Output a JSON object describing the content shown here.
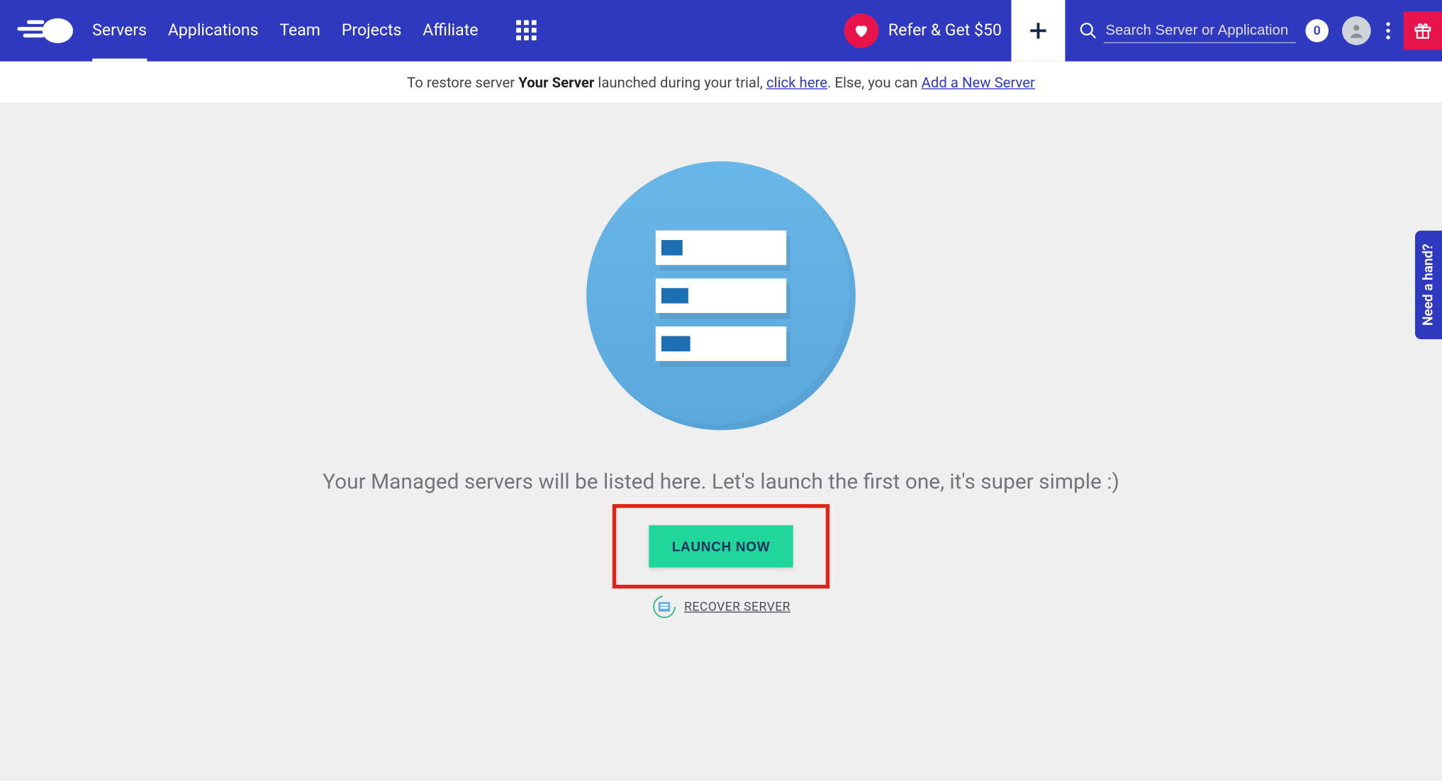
{
  "nav": {
    "items": [
      "Servers",
      "Applications",
      "Team",
      "Projects",
      "Affiliate"
    ],
    "active_index": 0
  },
  "refer": {
    "label": "Refer & Get $50"
  },
  "search": {
    "placeholder": "Search Server or Application",
    "count": "0"
  },
  "notice": {
    "pre": "To restore server ",
    "server_name": "Your Server",
    "mid": " launched during your trial, ",
    "link1": "click here",
    "post1": ". Else, you can ",
    "link2": "Add a New Server"
  },
  "main": {
    "empty_text": "Your Managed servers will be listed here. Let's launch the first one, it's super simple :)",
    "launch_label": "LAUNCH NOW",
    "recover_label": "RECOVER SERVER"
  },
  "side_tab": {
    "label": "Need a hand?"
  }
}
